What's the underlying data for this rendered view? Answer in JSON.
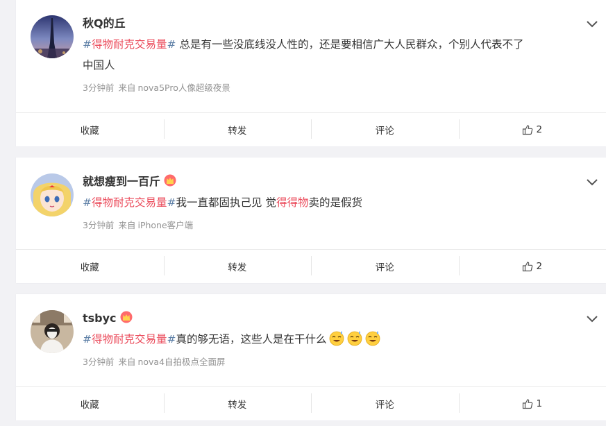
{
  "posts": [
    {
      "username": "秋Q的丘",
      "has_crown": false,
      "topic_hash_open": "#",
      "topic": "得物耐克交易量",
      "topic_hash_close": "#",
      "text_line1": " 总是有一些没底线没人性的，还是要相信广大人民群众，个别人代表不了",
      "text_line2": "中国人",
      "time": "3分钟前",
      "from_label": "来自",
      "device": "nova5Pro人像超级夜景",
      "actions": {
        "favorite": "收藏",
        "repost": "转发",
        "comment": "评论",
        "like_count": "2"
      }
    },
    {
      "username": "就想瘦到一百斤",
      "has_crown": true,
      "topic_hash_open": "#",
      "topic": "得物耐克交易量",
      "topic_hash_close": "#",
      "text_before_link": "我一直都固执己见 觉",
      "inline_link": "得得物",
      "text_after_link": "卖的是假货",
      "time": "3分钟前",
      "from_label": "来自",
      "device": "iPhone客户端",
      "actions": {
        "favorite": "收藏",
        "repost": "转发",
        "comment": "评论",
        "like_count": "2"
      }
    },
    {
      "username": "tsbyc",
      "has_crown": true,
      "topic_hash_open": "#",
      "topic": "得物耐克交易量",
      "topic_hash_close": "#",
      "text": "真的够无语，这些人是在干什么",
      "emoji_count": 3,
      "emoji_name": "sweat-smile-emoji",
      "time": "3分钟前",
      "from_label": "来自",
      "device": "nova4自拍极点全面屏",
      "actions": {
        "favorite": "收藏",
        "repost": "转发",
        "comment": "评论",
        "like_count": "1"
      }
    }
  ],
  "colors": {
    "topic_hash": "#5d7fa6",
    "topic_text": "#eb4c5c",
    "meta_text": "#939393",
    "background": "#f2f2f5"
  }
}
